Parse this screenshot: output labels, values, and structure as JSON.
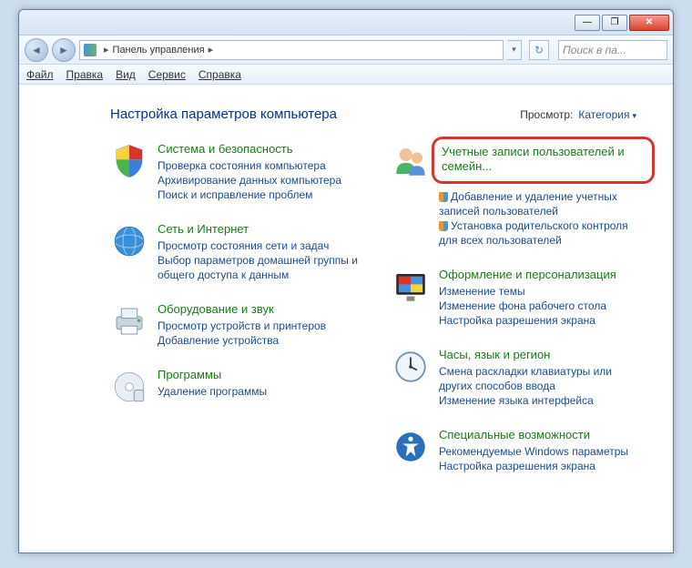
{
  "titlebar": {
    "min": "—",
    "max": "❐",
    "close": "✕"
  },
  "nav": {
    "addr_label": "Панель управления",
    "refresh_glyph": "↻",
    "search_placeholder": "Поиск в па..."
  },
  "menu": {
    "file": "Файл",
    "edit": "Правка",
    "view": "Вид",
    "tools": "Сервис",
    "help": "Справка"
  },
  "heading": "Настройка параметров компьютера",
  "view_selector": {
    "label": "Просмотр:",
    "value": "Категория"
  },
  "left": [
    {
      "title": "Система и безопасность",
      "links": [
        "Проверка состояния компьютера",
        "Архивирование данных компьютера",
        "Поиск и исправление проблем"
      ]
    },
    {
      "title": "Сеть и Интернет",
      "links": [
        "Просмотр состояния сети и задач",
        "Выбор параметров домашней группы и общего доступа к данным"
      ]
    },
    {
      "title": "Оборудование и звук",
      "links": [
        "Просмотр устройств и принтеров",
        "Добавление устройства"
      ]
    },
    {
      "title": "Программы",
      "links": [
        "Удаление программы"
      ]
    }
  ],
  "right": [
    {
      "title": "Учетные записи пользователей и семейн...",
      "highlighted": true,
      "links": [
        {
          "text": "Добавление и удаление учетных записей пользователей",
          "shield": true
        },
        {
          "text": "Установка родительского контроля для всех пользователей",
          "shield": true
        }
      ]
    },
    {
      "title": "Оформление и персонализация",
      "links": [
        {
          "text": "Изменение темы"
        },
        {
          "text": "Изменение фона рабочего стола"
        },
        {
          "text": "Настройка разрешения экрана"
        }
      ]
    },
    {
      "title": "Часы, язык и регион",
      "links": [
        {
          "text": "Смена раскладки клавиатуры или других способов ввода"
        },
        {
          "text": "Изменение языка интерфейса"
        }
      ]
    },
    {
      "title": "Специальные возможности",
      "links": [
        {
          "text": "Рекомендуемые Windows параметры"
        },
        {
          "text": "Настройка разрешения экрана"
        }
      ]
    }
  ]
}
